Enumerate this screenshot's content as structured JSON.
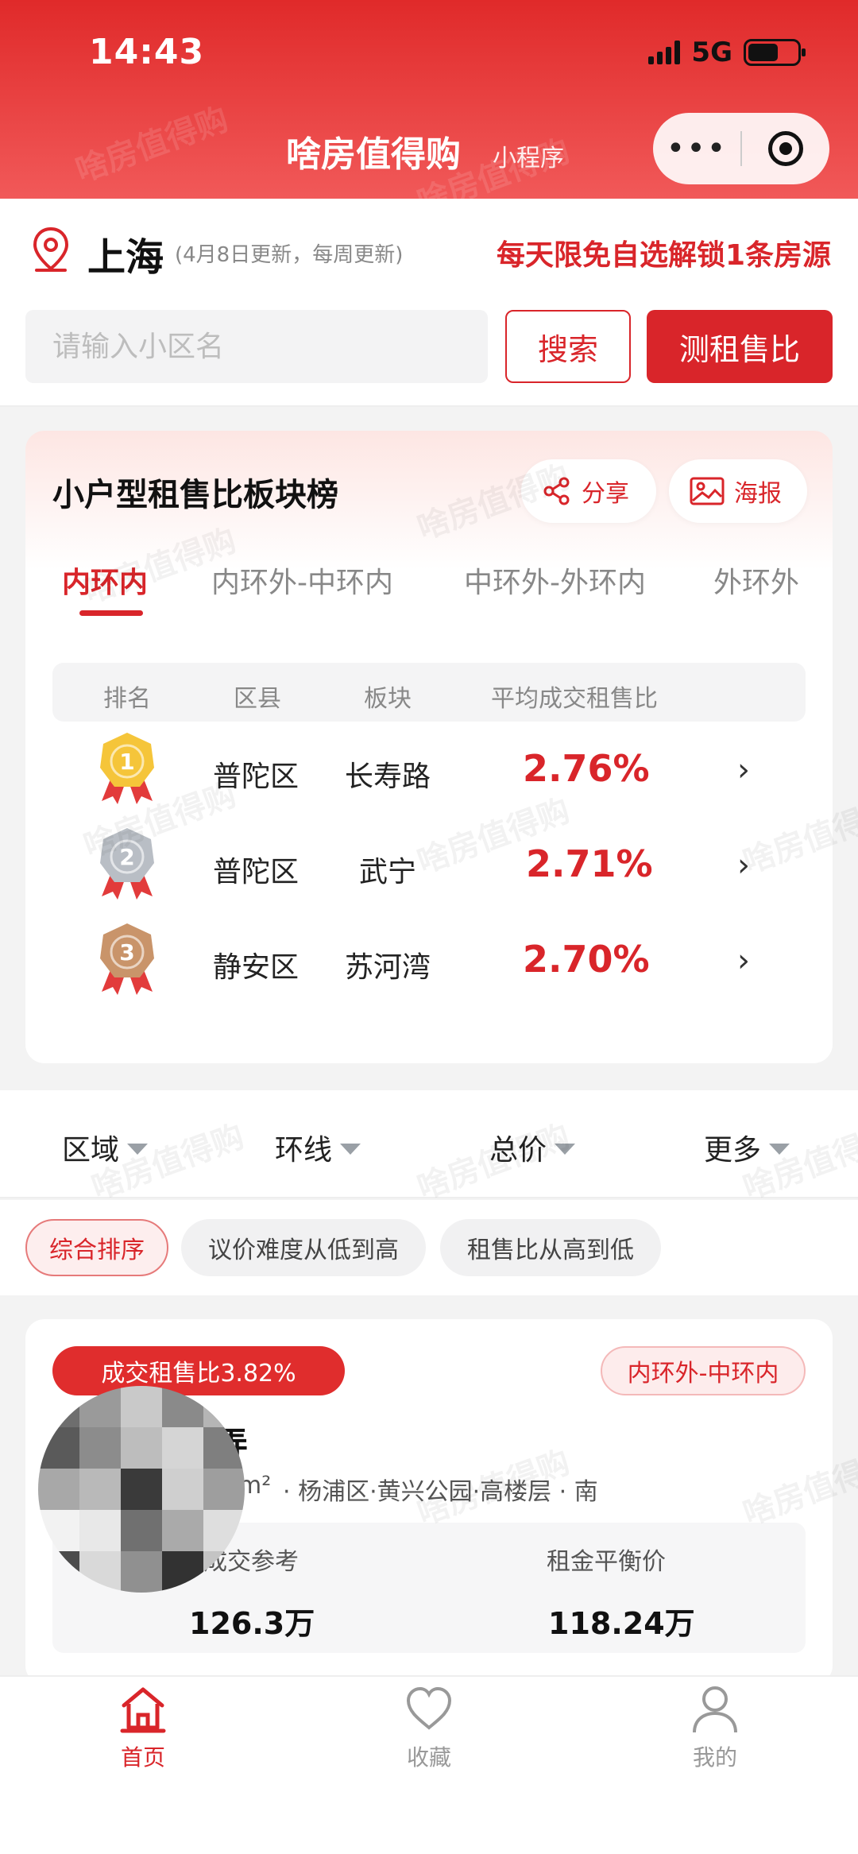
{
  "status_bar": {
    "time": "14:43",
    "network": "5G"
  },
  "app": {
    "title": "啥房值得购",
    "subtitle": "小程序",
    "menu_icon": "more-dots-icon",
    "close_icon": "target-icon"
  },
  "location": {
    "city": "上海",
    "update_note": "(4月8日更新，每周更新)",
    "promo": "每天限免自选解锁1条房源",
    "icon": "location-pin-icon"
  },
  "search": {
    "placeholder": "请输入小区名",
    "value": "",
    "search_label": "搜索",
    "measure_label": "测租售比"
  },
  "ranking": {
    "title": "小户型租售比板块榜",
    "share_label": "分享",
    "poster_label": "海报",
    "tabs": [
      "内环内",
      "内环外-中环内",
      "中环外-外环内",
      "外环外"
    ],
    "active_tab": 0,
    "headers": {
      "rank": "排名",
      "district": "区县",
      "block": "板块",
      "ratio": "平均成交租售比"
    },
    "rows": [
      {
        "rank": "1",
        "district": "普陀区",
        "block": "长寿路",
        "ratio": "2.76%",
        "medal_color": "#f5c53a"
      },
      {
        "rank": "2",
        "district": "普陀区",
        "block": "武宁",
        "ratio": "2.71%",
        "medal_color": "#b9bec5"
      },
      {
        "rank": "3",
        "district": "静安区",
        "block": "苏河湾",
        "ratio": "2.70%",
        "medal_color": "#c9946a"
      }
    ]
  },
  "filters": [
    "区域",
    "环线",
    "总价",
    "更多"
  ],
  "sort_chips": [
    "综合排序",
    "议价难度从低到高",
    "租售比从高到低"
  ],
  "listing": {
    "ratio_badge": "成交租售比3.82%",
    "ring_badge": "内环外-中环内",
    "name": "弄",
    "meta_prefix": "m²",
    "meta": "· 杨浦区·黄兴公园·高楼层 · 南",
    "deal_label": "成交参考",
    "deal_value": "126.3万",
    "balance_label": "租金平衡价",
    "balance_value": "118.24万"
  },
  "tabbar": [
    {
      "label": "首页",
      "icon": "home-icon",
      "active": true
    },
    {
      "label": "收藏",
      "icon": "heart-icon",
      "active": false
    },
    {
      "label": "我的",
      "icon": "user-icon",
      "active": false
    }
  ],
  "watermark_text": "啥房值得购",
  "colors": {
    "accent": "#d9252a",
    "header_top": "#e02a2a",
    "header_bottom": "#f15959"
  }
}
